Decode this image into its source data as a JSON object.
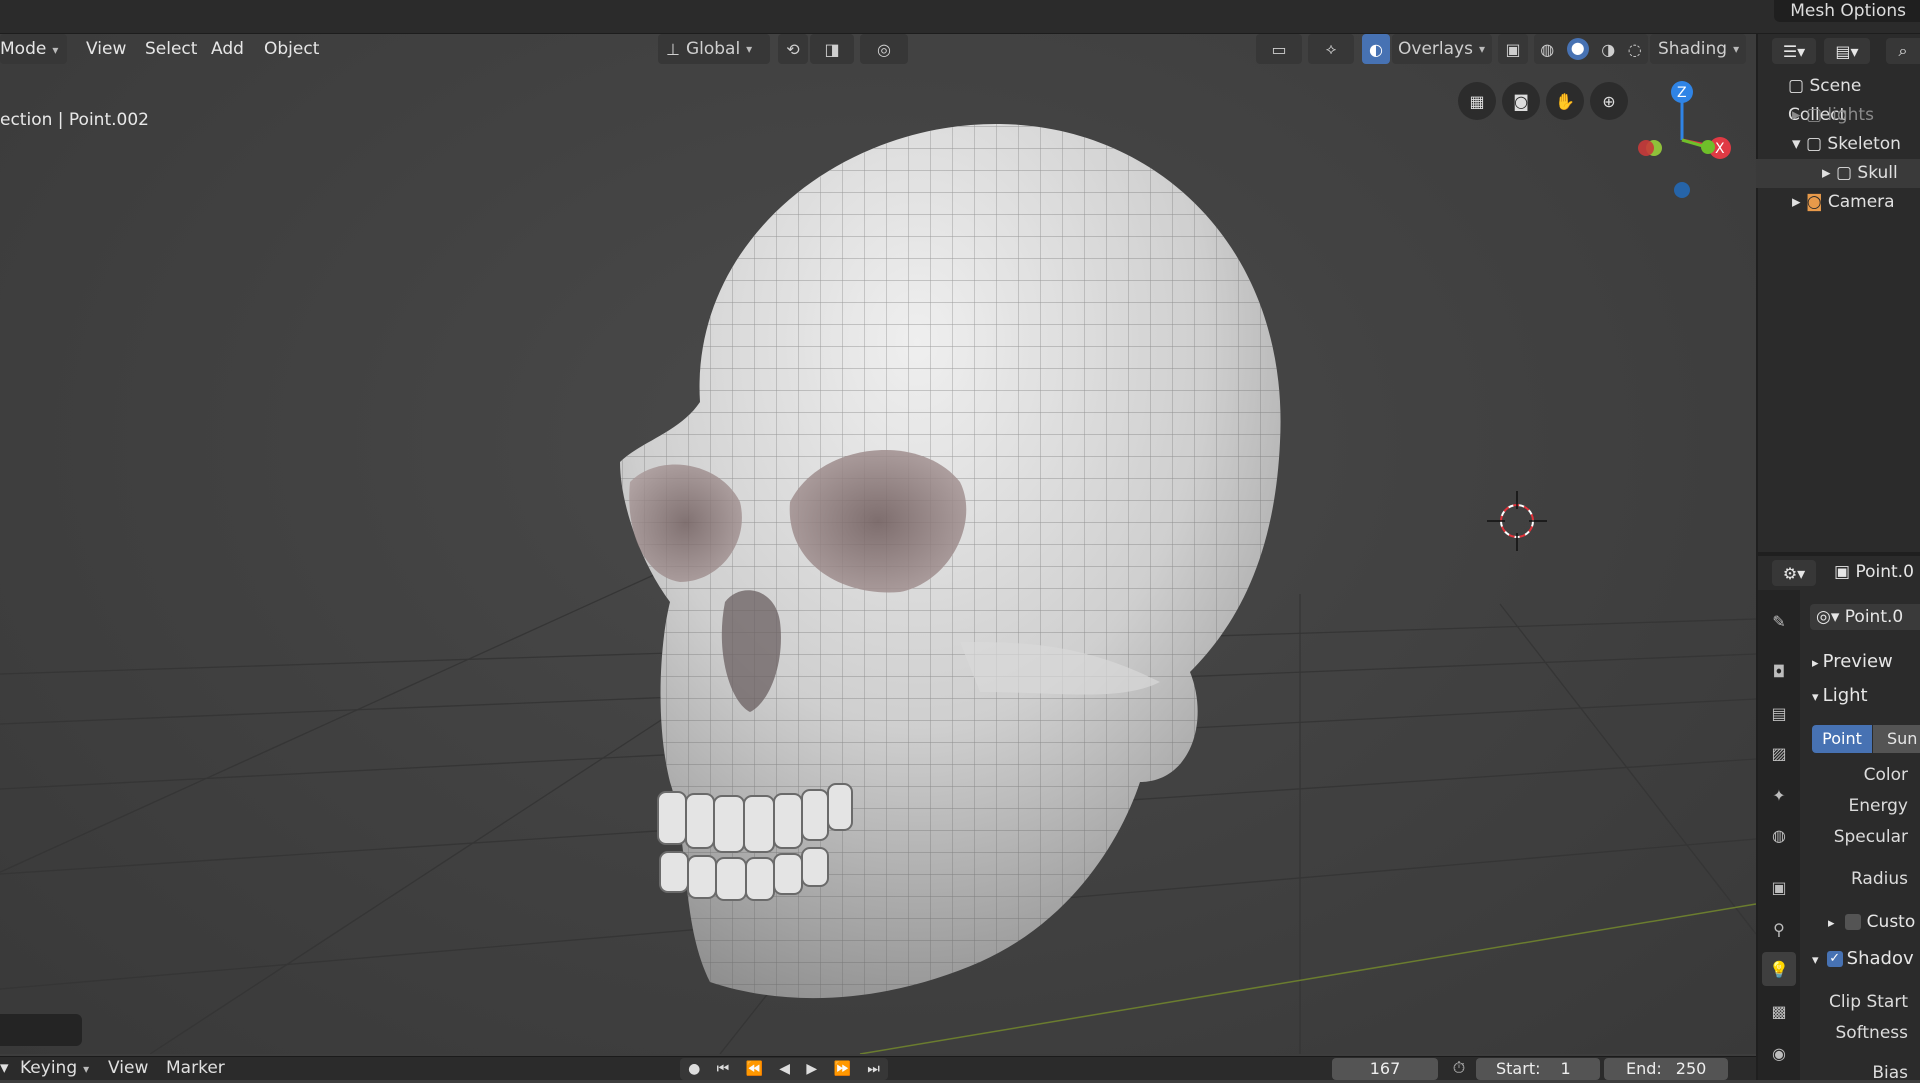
{
  "top_bar": {
    "mesh_options": "Mesh Options"
  },
  "viewport_header": {
    "mode": "Mode",
    "menus": [
      "View",
      "Select",
      "Add",
      "Object"
    ],
    "transform_orientation": "Global",
    "overlays": "Overlays",
    "shading": "Shading"
  },
  "viewport": {
    "status_text": "ection | Point.002",
    "gizmo_axes": {
      "z": "Z",
      "x": "X"
    }
  },
  "outliner": {
    "items": [
      {
        "label": "Scene Collect",
        "icon": "collection-icon"
      },
      {
        "label": "lights",
        "icon": "collection-icon",
        "excluded": true
      },
      {
        "label": "Skeleton",
        "icon": "collection-icon",
        "expanded": true
      },
      {
        "label": "Skull",
        "icon": "collection-icon",
        "selected": true
      },
      {
        "label": "Camera",
        "icon": "camera-icon"
      }
    ]
  },
  "properties": {
    "header_object": "Point.0",
    "data_name": "Point.0",
    "sections": {
      "preview": "Preview",
      "light": "Light",
      "custom": "Custo",
      "shadow": "Shadov"
    },
    "light_types": [
      "Point",
      "Sun"
    ],
    "active_light_type": "Point",
    "fields": [
      "Color",
      "Energy",
      "Specular",
      "Radius",
      "Clip Start",
      "Softness",
      "Bias"
    ]
  },
  "timeline": {
    "menus": [
      "Keying",
      "View",
      "Marker"
    ],
    "current_frame": "167",
    "start": "Start:",
    "start_value": "1",
    "end": "End:",
    "end_value": "250"
  },
  "colors": {
    "accent": "#4772b3",
    "panel": "#2b2b2b",
    "viewport": "#414141",
    "x_axis": "#e03a44",
    "y_axis": "#6fbf2a",
    "z_axis": "#2f84e6"
  }
}
